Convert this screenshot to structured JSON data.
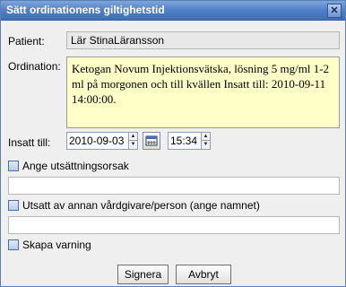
{
  "window": {
    "title": "Sätt ordinationens giltighetstid",
    "close_glyph": "✕"
  },
  "patient": {
    "label": "Patient:",
    "value": "Lär StinaLäransson"
  },
  "ordination": {
    "label": "Ordination:",
    "text": "Ketogan Novum Injektionsvätska, lösning 5 mg/ml 1-2 ml på morgonen och till kvällen Insatt till: 2010-09-11 14:00:00."
  },
  "insatt_till": {
    "label": "Insatt till:",
    "date": "2010-09-03",
    "time": "15:34"
  },
  "checkboxes": {
    "ange_utsattningsorsak": "Ange utsättningsorsak",
    "utsatt_av_annan": "Utsatt av annan vårdgivare/person (ange namnet)",
    "skapa_varning": "Skapa varning"
  },
  "buttons": {
    "signera": "Signera",
    "avbryt": "Avbryt"
  },
  "icons": {
    "spinner_up": "▲",
    "spinner_down": "▼"
  }
}
